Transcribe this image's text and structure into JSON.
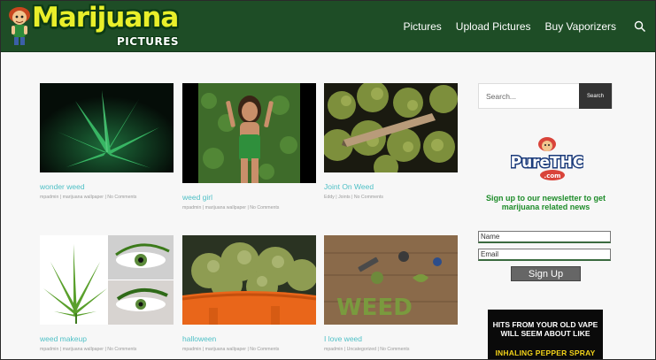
{
  "header": {
    "logo_text_main": "Marijuana",
    "logo_text_sub": "PICTURES",
    "nav": [
      "Pictures",
      "Upload Pictures",
      "Buy Vaporizers"
    ]
  },
  "posts": [
    {
      "title": "wonder weed",
      "author": "mpadmin",
      "category": "marijuana wallpaper",
      "comments": "No Comments"
    },
    {
      "title": "weed girl",
      "author": "mpadmin",
      "category": "marijuana wallpaper",
      "comments": "No Comments"
    },
    {
      "title": "Joint On Weed",
      "author": "Eddy",
      "category": "Joints",
      "comments": "No Comments"
    },
    {
      "title": "weed makeup",
      "author": "mpadmin",
      "category": "marijuana wallpaper",
      "comments": "No Comments"
    },
    {
      "title": "halloween",
      "author": "mpadmin",
      "category": "marijuana wallpaper",
      "comments": "No Comments"
    },
    {
      "title": "I love weed",
      "author": "mpadmin",
      "category": "Uncategorized",
      "comments": "No Comments"
    }
  ],
  "sidebar": {
    "search_placeholder": "Search...",
    "search_button": "Search",
    "pure_logo_text": "PureTHC",
    "pure_logo_sub": ".com",
    "newsletter_text": "Sign up to our newsletter to get marijuana related news",
    "name_placeholder": "Name",
    "email_placeholder": "Email",
    "signup_label": "Sign Up",
    "ad_line1": "HITS FROM YOUR OLD VAPE WILL SEEM ABOUT LIKE",
    "ad_line2": "INHALING PEPPER SPRAY"
  },
  "colors": {
    "header_bg": "#1e4d26",
    "logo_yellow": "#e9ef2a",
    "link_teal": "#4fc0c6",
    "newsletter_green": "#1e8c2a",
    "ad_yellow": "#f2d21a"
  }
}
